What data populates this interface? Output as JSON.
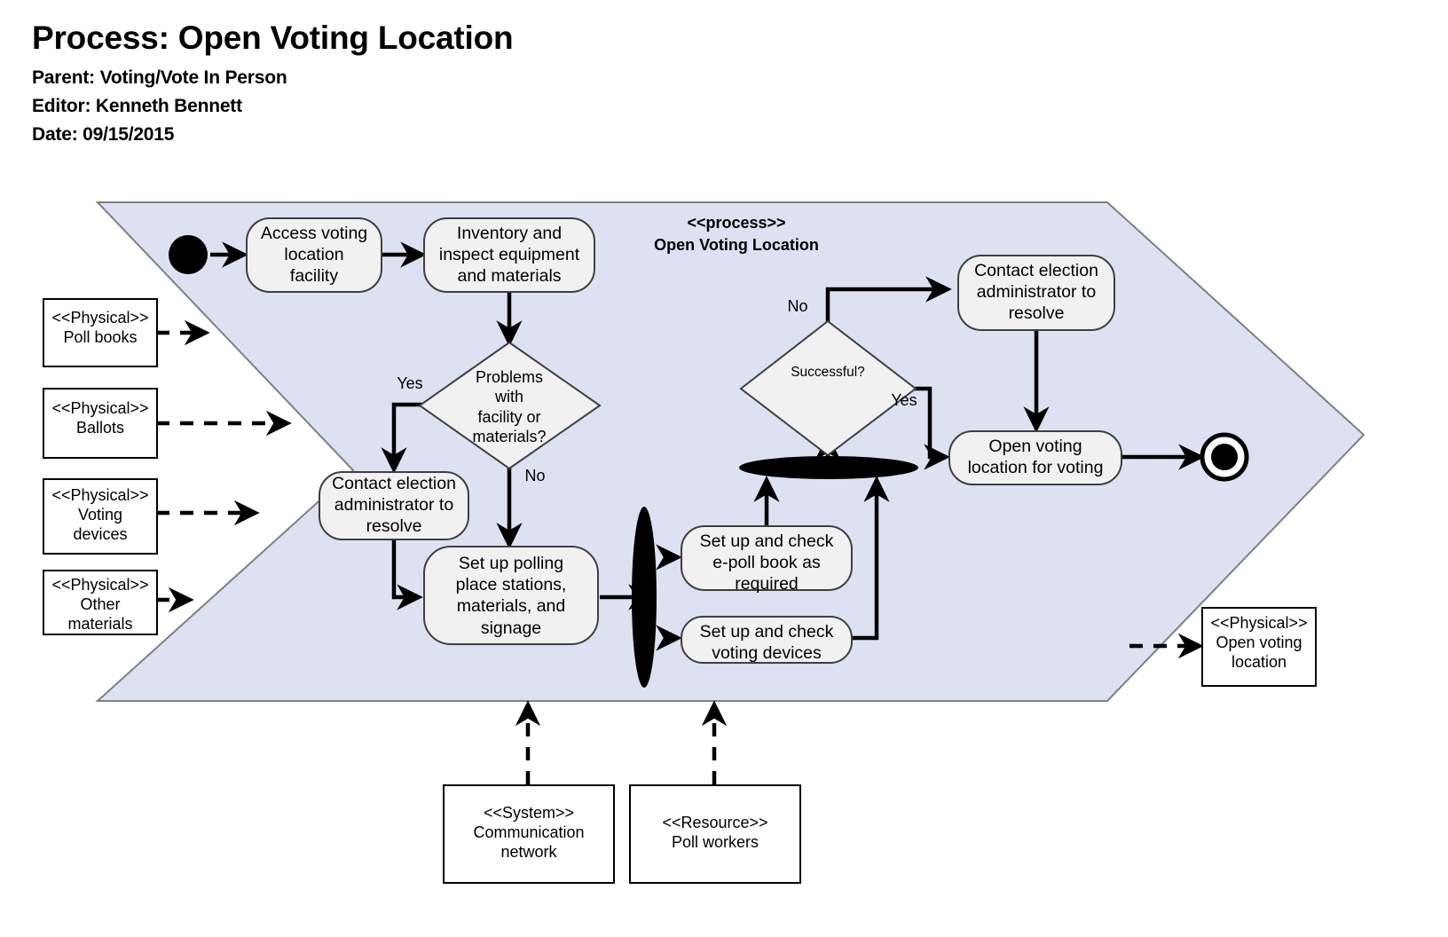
{
  "header": {
    "title": "Process: Open Voting Location",
    "parent": "Parent: Voting/Vote In Person",
    "editor": "Editor: Kenneth Bennett",
    "date": "Date: 09/15/2015"
  },
  "container": {
    "stereotype": "<<process>>",
    "name": "Open Voting Location",
    "fill": "#dce2f1",
    "stroke": "#808080"
  },
  "colors": {
    "node_fill": "#f1f1f1",
    "node_stroke": "#3f3f3f",
    "object_fill": "#ffffff",
    "object_stroke": "#000000",
    "flow": "#000000"
  },
  "nodes": {
    "start": "initial-node",
    "end": "final-node",
    "activities": [
      {
        "id": "access-facility",
        "label": "Access voting\nlocation\nfacility"
      },
      {
        "id": "inventory-inspect",
        "label": "Inventory and\ninspect equipment\nand materials"
      },
      {
        "id": "contact-admin-1",
        "label": "Contact election\nadministrator to\nresolve"
      },
      {
        "id": "setup-polling-place",
        "label": "Set up polling\nplace stations,\nmaterials, and\nsignage"
      },
      {
        "id": "setup-epoll-book",
        "label": "Set up and check\ne-poll book as\nrequired"
      },
      {
        "id": "setup-voting-devices",
        "label": "Set up and check\nvoting devices"
      },
      {
        "id": "contact-admin-2",
        "label": "Contact election\nadministrator to\nresolve"
      },
      {
        "id": "open-location",
        "label": "Open voting\nlocation for voting"
      }
    ],
    "decisions": [
      {
        "id": "problems-decision",
        "label": "Problems\nwith\nfacility or\nmaterials?"
      },
      {
        "id": "successful-decision",
        "label": "Successful?"
      }
    ],
    "forks": [
      {
        "id": "fork-bar",
        "orientation": "vertical"
      },
      {
        "id": "join-bar",
        "orientation": "horizontal"
      }
    ]
  },
  "guards": [
    {
      "id": "guard-problems-yes",
      "text": "Yes"
    },
    {
      "id": "guard-problems-no",
      "text": "No"
    },
    {
      "id": "guard-successful-no",
      "text": "No"
    },
    {
      "id": "guard-successful-yes",
      "text": "Yes"
    }
  ],
  "objects": {
    "inputs": [
      {
        "id": "poll-books",
        "stereotype": "<<Physical>>",
        "name": "Poll books"
      },
      {
        "id": "ballots",
        "stereotype": "<<Physical>>",
        "name": "Ballots"
      },
      {
        "id": "voting-devices",
        "stereotype": "<<Physical>>",
        "name": "Voting\ndevices"
      },
      {
        "id": "other-materials",
        "stereotype": "<<Physical>>",
        "name": "Other\nmaterials"
      }
    ],
    "outputs": [
      {
        "id": "open-voting-location",
        "stereotype": "<<Physical>>",
        "name": "Open voting\nlocation"
      }
    ],
    "supports": [
      {
        "id": "communication-network",
        "stereotype": "<<System>>",
        "name": "Communication\nnetwork"
      },
      {
        "id": "poll-workers",
        "stereotype": "<<Resource>>",
        "name": "Poll workers"
      }
    ]
  }
}
